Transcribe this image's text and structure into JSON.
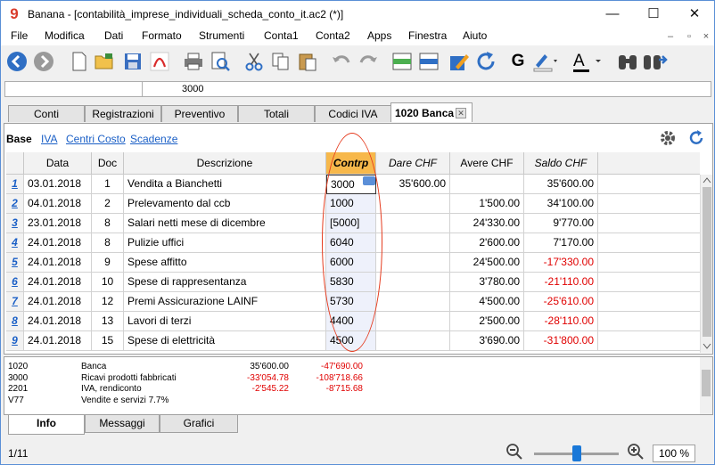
{
  "window": {
    "app_icon": "9",
    "title": "Banana - [contabilità_imprese_individuali_scheda_conto_it.ac2 (*)]",
    "controls": {
      "minimize": "—",
      "maximize": "☐",
      "close": "✕"
    },
    "mdi_controls": {
      "minimize": "–",
      "restore": "▫",
      "close": "×"
    }
  },
  "menu": [
    "File",
    "Modifica",
    "Dati",
    "Formato",
    "Strumenti",
    "Conta1",
    "Conta2",
    "Apps",
    "Finestra",
    "Aiuto"
  ],
  "toolbar_icons": [
    "back-icon",
    "forward-icon",
    "new-file-icon",
    "open-folder-icon",
    "save-icon",
    "pdf-icon",
    "print-icon",
    "print-preview-icon",
    "cut-icon",
    "copy-icon",
    "paste-icon",
    "undo-icon",
    "redo-icon",
    "add-row-icon",
    "delete-row-icon",
    "edit-pencil-icon",
    "refresh-icon",
    "bold-icon",
    "highlight-icon",
    "font-color-icon",
    "binoculars-icon",
    "find-next-icon"
  ],
  "toolbar_glyphs": {
    "bold": "G",
    "font_color": "A"
  },
  "cell_bar": {
    "address": "",
    "value": "3000"
  },
  "tabs": [
    "Conti",
    "Registrazioni",
    "Preventivo",
    "Totali",
    "Codici IVA",
    "1020 Banca"
  ],
  "active_tab_close": "✕",
  "views": [
    "Base",
    "IVA",
    "Centri Costo",
    "Scadenze"
  ],
  "columns": [
    "",
    "Data",
    "Doc",
    "Descrizione",
    "Contrp",
    "Dare CHF",
    "Avere CHF",
    "Saldo CHF"
  ],
  "rows": [
    {
      "n": "1",
      "data": "03.01.2018",
      "doc": "1",
      "descr": "Vendita a Bianchetti",
      "contrp": "3000",
      "dare": "35'600.00",
      "avere": "",
      "saldo": "35'600.00",
      "neg": false
    },
    {
      "n": "2",
      "data": "04.01.2018",
      "doc": "2",
      "descr": "Prelevamento dal ccb",
      "contrp": "1000",
      "dare": "",
      "avere": "1'500.00",
      "saldo": "34'100.00",
      "neg": false
    },
    {
      "n": "3",
      "data": "23.01.2018",
      "doc": "8",
      "descr": "Salari netti mese di dicembre",
      "contrp": "[5000]",
      "dare": "",
      "avere": "24'330.00",
      "saldo": "9'770.00",
      "neg": false
    },
    {
      "n": "4",
      "data": "24.01.2018",
      "doc": "8",
      "descr": "Pulizie uffici",
      "contrp": "6040",
      "dare": "",
      "avere": "2'600.00",
      "saldo": "7'170.00",
      "neg": false
    },
    {
      "n": "5",
      "data": "24.01.2018",
      "doc": "9",
      "descr": "Spese affitto",
      "contrp": "6000",
      "dare": "",
      "avere": "24'500.00",
      "saldo": "-17'330.00",
      "neg": true
    },
    {
      "n": "6",
      "data": "24.01.2018",
      "doc": "10",
      "descr": "Spese di rappresentanza",
      "contrp": "5830",
      "dare": "",
      "avere": "3'780.00",
      "saldo": "-21'110.00",
      "neg": true
    },
    {
      "n": "7",
      "data": "24.01.2018",
      "doc": "12",
      "descr": "Premi Assicurazione LAINF",
      "contrp": "5730",
      "dare": "",
      "avere": "4'500.00",
      "saldo": "-25'610.00",
      "neg": true
    },
    {
      "n": "8",
      "data": "24.01.2018",
      "doc": "13",
      "descr": "Lavori di terzi",
      "contrp": "4400",
      "dare": "",
      "avere": "2'500.00",
      "saldo": "-28'110.00",
      "neg": true
    },
    {
      "n": "9",
      "data": "24.01.2018",
      "doc": "15",
      "descr": "Spese di elettricità",
      "contrp": "4500",
      "dare": "",
      "avere": "3'690.00",
      "saldo": "-31'800.00",
      "neg": true
    }
  ],
  "info_rows": [
    {
      "code": "1020",
      "name": "Banca",
      "v1": "35'600.00",
      "v2": "-47'690.00",
      "v1neg": false,
      "v2neg": true
    },
    {
      "code": "3000",
      "name": "Ricavi prodotti fabbricati",
      "v1": "-33'054.78",
      "v2": "-108'718.66",
      "v1neg": true,
      "v2neg": true
    },
    {
      "code": "2201",
      "name": "IVA, rendiconto",
      "v1": "-2'545.22",
      "v2": "-8'715.68",
      "v1neg": true,
      "v2neg": true
    },
    {
      "code": "V77",
      "name": "Vendite e servizi 7.7%",
      "v1": "",
      "v2": "",
      "v1neg": false,
      "v2neg": false
    }
  ],
  "bottom_tabs": [
    "Info",
    "Messaggi",
    "Grafici"
  ],
  "status": {
    "page": "1/11",
    "zoom": "100 %",
    "zoom_level_percent": 100
  },
  "colors": {
    "accent": "#1a5fc6",
    "negative": "#e00000",
    "contrp_header": "#f7b84b",
    "annotation_oval": "#e53b1e"
  }
}
